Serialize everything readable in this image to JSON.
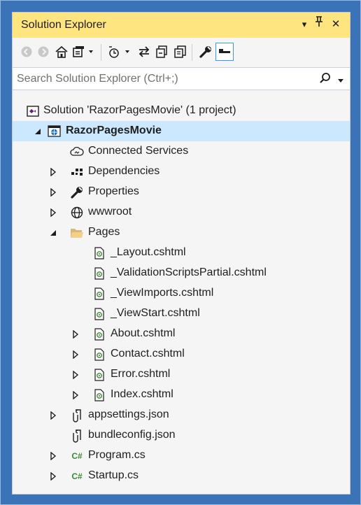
{
  "window": {
    "title": "Solution Explorer",
    "dropdown_glyph": "▾",
    "pin_glyph": "ᛘ",
    "close_glyph": "✕"
  },
  "search": {
    "placeholder": "Search Solution Explorer (Ctrl+;)"
  },
  "toolbar": {
    "icons": [
      "back-icon",
      "forward-icon",
      "home-icon",
      "switch-views-icon",
      "pending-changes-filter-icon",
      "sync-icon",
      "collapse-all-icon",
      "show-all-files-icon",
      "properties-icon",
      "preview-icon"
    ]
  },
  "tree": {
    "solution": "Solution 'RazorPagesMovie' (1 project)",
    "project": "RazorPagesMovie",
    "connected_services": "Connected Services",
    "dependencies": "Dependencies",
    "properties": "Properties",
    "wwwroot": "wwwroot",
    "pages": "Pages",
    "layout": "_Layout.cshtml",
    "validation": "_ValidationScriptsPartial.cshtml",
    "viewimports": "_ViewImports.cshtml",
    "viewstart": "_ViewStart.cshtml",
    "about": "About.cshtml",
    "contact": "Contact.cshtml",
    "error": "Error.cshtml",
    "index": "Index.cshtml",
    "appsettings": "appsettings.json",
    "bundleconfig": "bundleconfig.json",
    "program": "Program.cs",
    "startup": "Startup.cs",
    "csharp_badge": "C#"
  },
  "colors": {
    "titlebar": "#ffe57f",
    "selection": "#cce8ff",
    "frame": "#3a73b7"
  }
}
